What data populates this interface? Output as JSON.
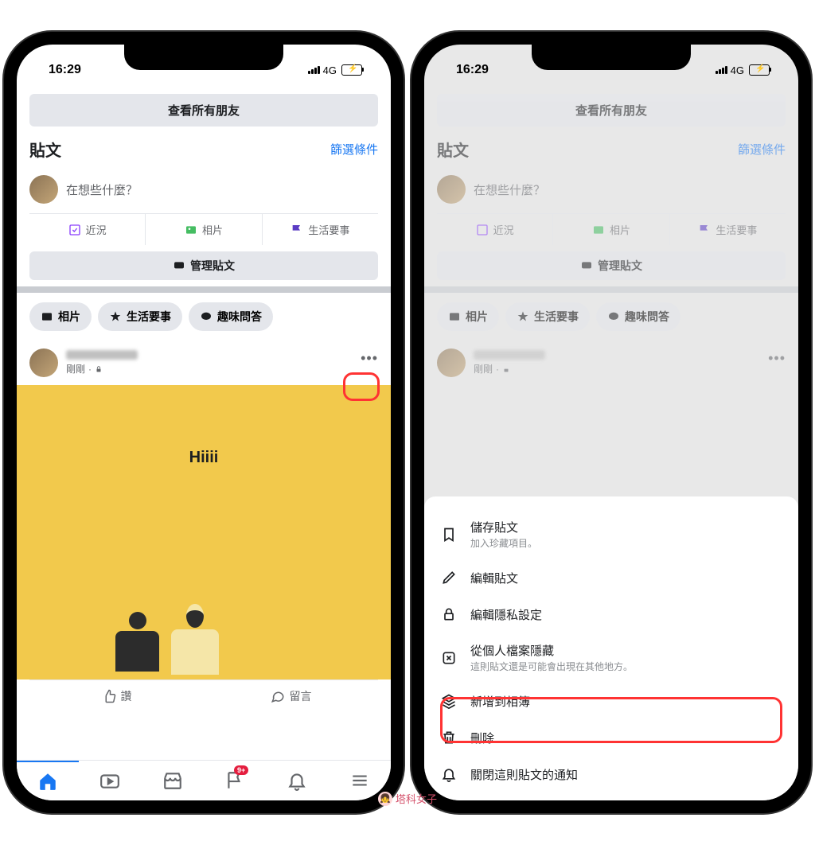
{
  "status": {
    "time": "16:29",
    "network": "4G"
  },
  "friends_button": "查看所有朋友",
  "posts": {
    "title": "貼文",
    "filter": "篩選條件"
  },
  "composer": {
    "prompt": "在想些什麼？",
    "status": "近況",
    "photo": "相片",
    "life_event": "生活要事"
  },
  "manage": "管理貼文",
  "pills": {
    "photo": "相片",
    "life_event": "生活要事",
    "qa": "趣味問答"
  },
  "post": {
    "time": "剛剛",
    "text": "Hiiii"
  },
  "actions": {
    "like": "讚",
    "comment": "留言"
  },
  "tabs": {
    "notifications_badge": "9+"
  },
  "sheet": {
    "save": {
      "title": "儲存貼文",
      "sub": "加入珍藏項目。"
    },
    "edit": "編輯貼文",
    "privacy": "編輯隱私設定",
    "hide": {
      "title": "從個人檔案隱藏",
      "sub": "這則貼文還是可能會出現在其他地方。"
    },
    "album": "新增到相簿",
    "delete": "刪除",
    "notifications_off": "關閉這則貼文的通知"
  },
  "watermark": "塔科女子"
}
